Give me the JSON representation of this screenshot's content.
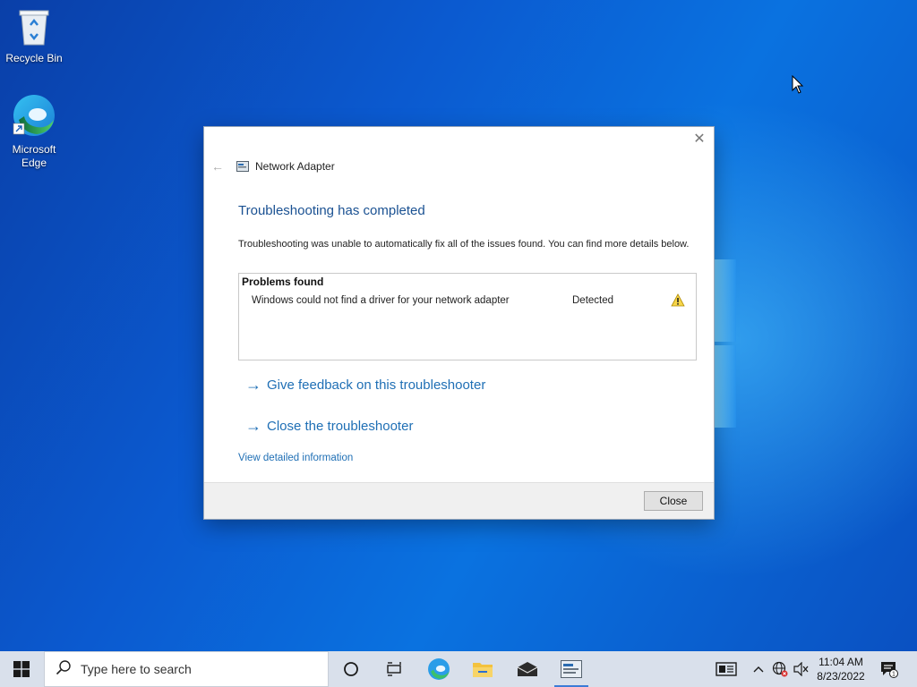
{
  "desktop": {
    "icons": [
      {
        "label": "Recycle Bin"
      },
      {
        "label": "Microsoft Edge"
      }
    ]
  },
  "dialog": {
    "header_title": "Network Adapter",
    "title": "Troubleshooting has completed",
    "description": "Troubleshooting was unable to automatically fix all of the issues found. You can find more details below.",
    "problems": {
      "heading": "Problems found",
      "rows": [
        {
          "issue": "Windows could not find a driver for your network adapter",
          "status": "Detected",
          "icon": "warning-icon"
        }
      ]
    },
    "links": {
      "feedback": "Give feedback on this troubleshooter",
      "close_troubleshooter": "Close the troubleshooter",
      "details": "View detailed information"
    },
    "close_button": "Close"
  },
  "taskbar": {
    "search_placeholder": "Type here to search",
    "clock_time": "11:04 AM",
    "clock_date": "8/23/2022",
    "notification_count": "1"
  }
}
